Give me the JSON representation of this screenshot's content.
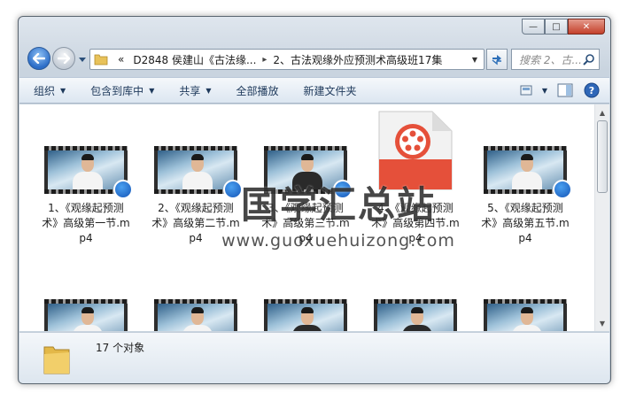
{
  "window": {
    "minimize_glyph": "—",
    "restore_glyph": "□",
    "close_glyph": "✕"
  },
  "address": {
    "chevron": "«",
    "parts": [
      "D2848 侯建山《古法缘...",
      "2、古法观缘外应预测术高级班17集"
    ],
    "separator": "▸"
  },
  "search": {
    "placeholder": "搜索 2、古..."
  },
  "toolbar": {
    "items": [
      {
        "label": "组织",
        "dropdown": true
      },
      {
        "label": "包含到库中",
        "dropdown": true
      },
      {
        "label": "共享",
        "dropdown": true
      },
      {
        "label": "全部播放",
        "dropdown": false
      },
      {
        "label": "新建文件夹",
        "dropdown": false
      }
    ],
    "right_icons": [
      "view-options-icon",
      "preview-pane-icon",
      "help-icon"
    ],
    "dropdown_glyph": "▼"
  },
  "files": [
    {
      "label": "1、《观缘起预测术》高级第一节.mp4"
    },
    {
      "label": "2、《观缘起预测术》高级第二节.mp4"
    },
    {
      "label": "3、《观缘起预测术》高级第三节.mp4"
    },
    {
      "label": "4、《观缘起预测术》高级第四节.mp4"
    },
    {
      "label": "5、《观缘起预测术》高级第五节.mp4"
    }
  ],
  "files_row2_count": 5,
  "watermark": {
    "title": "国学汇总站",
    "url": "www.guoxuehuizong.com"
  },
  "details": {
    "count_text": "17 个对象"
  },
  "colors": {
    "accent": "#2c6dc7",
    "close": "#c4402b",
    "doc_red": "#e5503a",
    "toolbar_text": "#1e395b"
  }
}
